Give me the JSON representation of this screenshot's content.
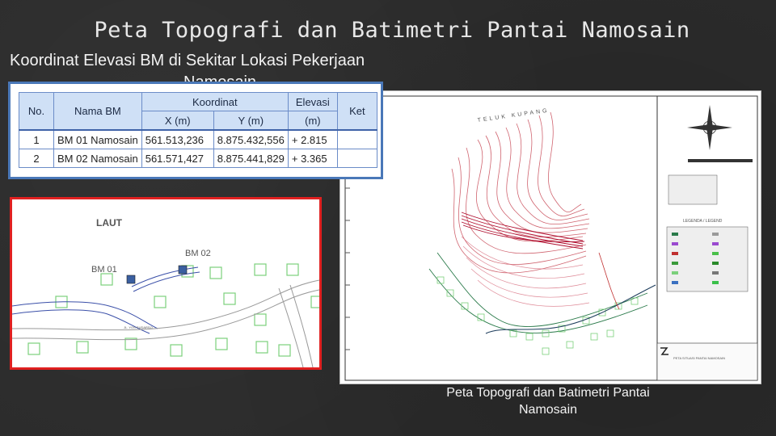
{
  "slide": {
    "title": "Peta Topografi dan Batimetri Pantai Namosain",
    "subtitle_line1": "Koordinat Elevasi BM di Sekitar Lokasi  Pekerjaan",
    "subtitle_line2": "Namosain",
    "caption_line1": "Peta Topografi dan Batimetri Pantai",
    "caption_line2": "Namosain"
  },
  "bm_table": {
    "headers": {
      "no": "No.",
      "nama": "Nama BM",
      "koordinat": "Koordinat",
      "x": "X (m)",
      "y": "Y (m)",
      "elevasi": "Elevasi",
      "elevasi_unit": "(m)",
      "ket": "Ket"
    },
    "rows": [
      {
        "no": "1",
        "nama": "BM 01 Namosain",
        "x": "561.513,236",
        "y": "8.875.432,556",
        "elevasi": "+ 2.815",
        "ket": ""
      },
      {
        "no": "2",
        "nama": "BM 02 Namosain",
        "x": "561.571,427",
        "y": "8.875.441,829",
        "elevasi": "+ 3.365",
        "ket": ""
      }
    ]
  },
  "location_map": {
    "laut": "LAUT",
    "bm01": "BM 01",
    "bm02": "BM 02",
    "road": "JL. YOS SUDARSO"
  },
  "topo_map": {
    "bay_label": "TELUK KUPANG",
    "legend_title": "LEGENDA / LEGEND",
    "title_block": "PETA SITUASI PANTAI NAMOSAIN"
  },
  "colors": {
    "background": "#2b2b2b",
    "table_border": "#4a78b8",
    "header_fill": "#cfe0f6",
    "map_border_red": "#e02020",
    "contour_red": "#c0303f"
  }
}
